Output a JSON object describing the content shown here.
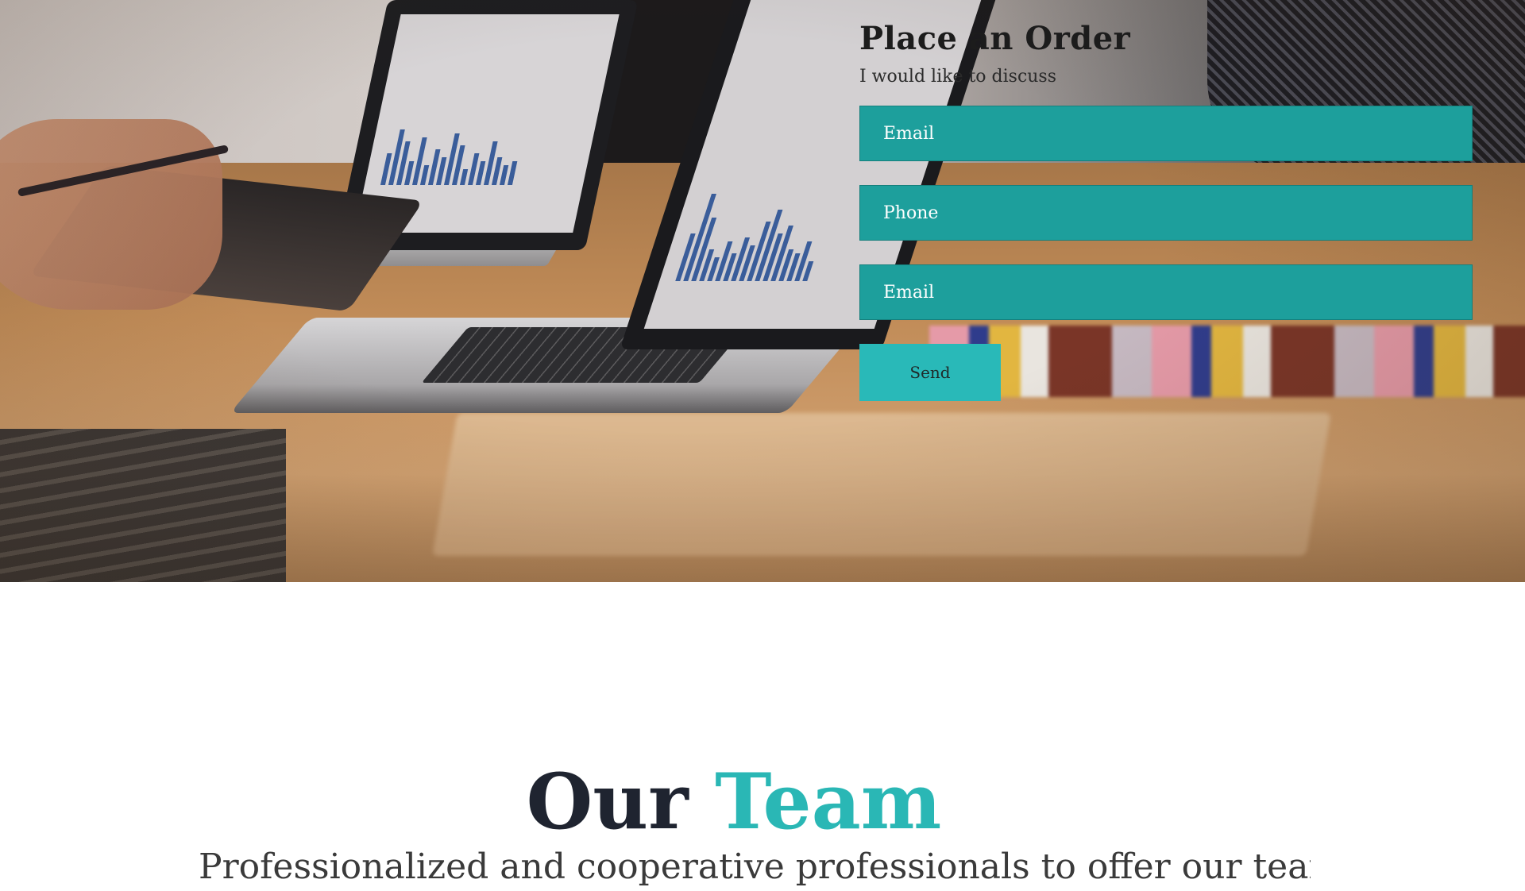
{
  "order": {
    "title": "Place an Order",
    "subtitle": "I would like to discuss",
    "fields": [
      {
        "placeholder": "Email"
      },
      {
        "placeholder": "Phone"
      },
      {
        "placeholder": "Email"
      }
    ],
    "send_label": "Send"
  },
  "team": {
    "title_part1": "Our",
    "title_part2": "Team",
    "subtitle": "Professionalized and cooperative professionals to offer our team making for"
  },
  "colors": {
    "accent": "#2ab7b5",
    "field_bg": "#1d9f9c",
    "button_bg": "#29b9b8",
    "heading": "#1f2430"
  },
  "hero": {
    "image": "office-desk-laptops-photo"
  }
}
